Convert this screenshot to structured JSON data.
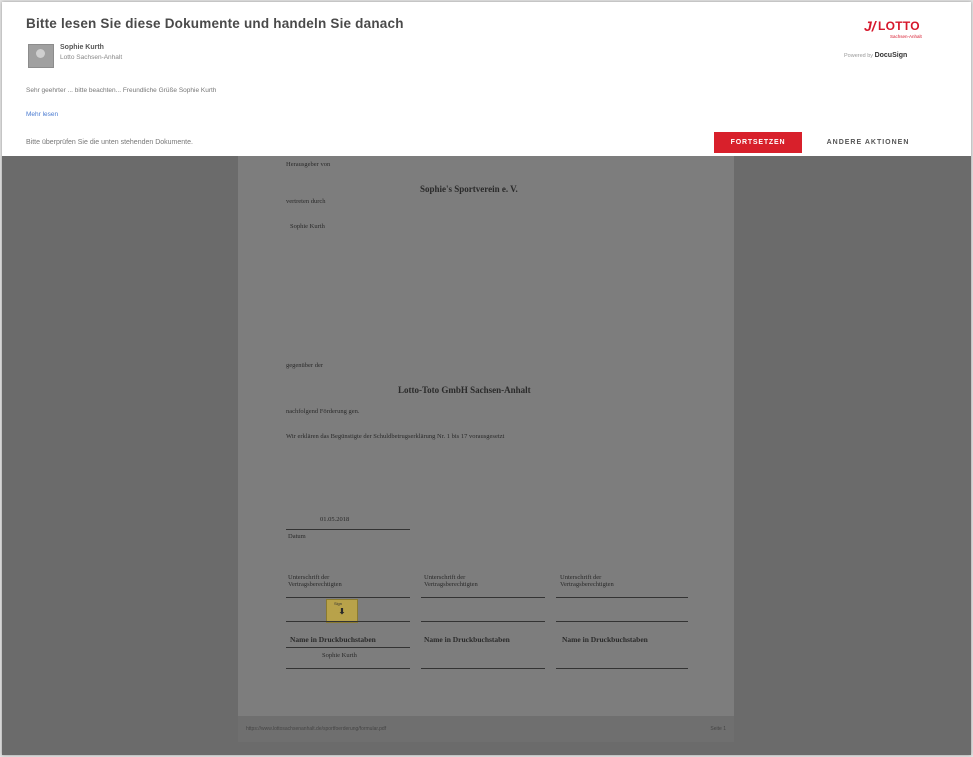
{
  "header": {
    "title": "Bitte lesen Sie diese Dokumente und handeln Sie danach",
    "sender_name": "Sophie Kurth",
    "sender_org": "Lotto Sachsen-Anhalt",
    "message": "Sehr geehrter ... bitte beachten... Freundliche Grüße Sophie Kurth",
    "more_link": "Mehr lesen",
    "instruction": "Bitte überprüfen Sie die unten stehenden Dokumente.",
    "continue_label": "FORTSETZEN",
    "other_actions_label": "ANDERE AKTIONEN",
    "powered_by_prefix": "Powered by",
    "powered_by_brand": "DocuSign"
  },
  "logo": {
    "mark": "J/",
    "text": "LOTTO",
    "subtext": "Sachsen-Anhalt"
  },
  "document": {
    "label_vertreten": "Herausgeber von",
    "club_name": "Sophie's Sportverein e. V.",
    "vertreten_durch": "vertreten durch",
    "person": "Sophie Kurth",
    "gegenueber": "gegenüber der",
    "company": "Lotto-Toto GmbH Sachsen-Anhalt",
    "weitergabe": "nachfolgend Förderung gen.",
    "bestaetigung": "Wir erklären das Begünstigte der Schuldbetrugserklärung Nr. 1 bis 17 vorausgesetzt",
    "date_value": "01.05.2018",
    "date_label": "Datum",
    "sig_col1": "Unterschrift der Vertragsberechtigten",
    "sig_col2": "Unterschrift der Vertragsberechtigten",
    "sig_col3": "Unterschrift der Vertragsberechtigten",
    "stamp_label": "Sign",
    "stamp_icon": "down-arrow-icon",
    "name_col1": "Name in Druckbuchstaben",
    "name_col2": "Name in Druckbuchstaben",
    "name_col3": "Name in Druckbuchstaben",
    "name_value1": "Sophie Kurth"
  },
  "footer": {
    "url": "https://www.lottosachsenanhalt.de/sportfoerderung/formular.pdf",
    "page": "Seite 1"
  },
  "colors": {
    "accent": "#d8202b",
    "overlay": "#6b6b6b",
    "link": "#4a7bd1"
  }
}
